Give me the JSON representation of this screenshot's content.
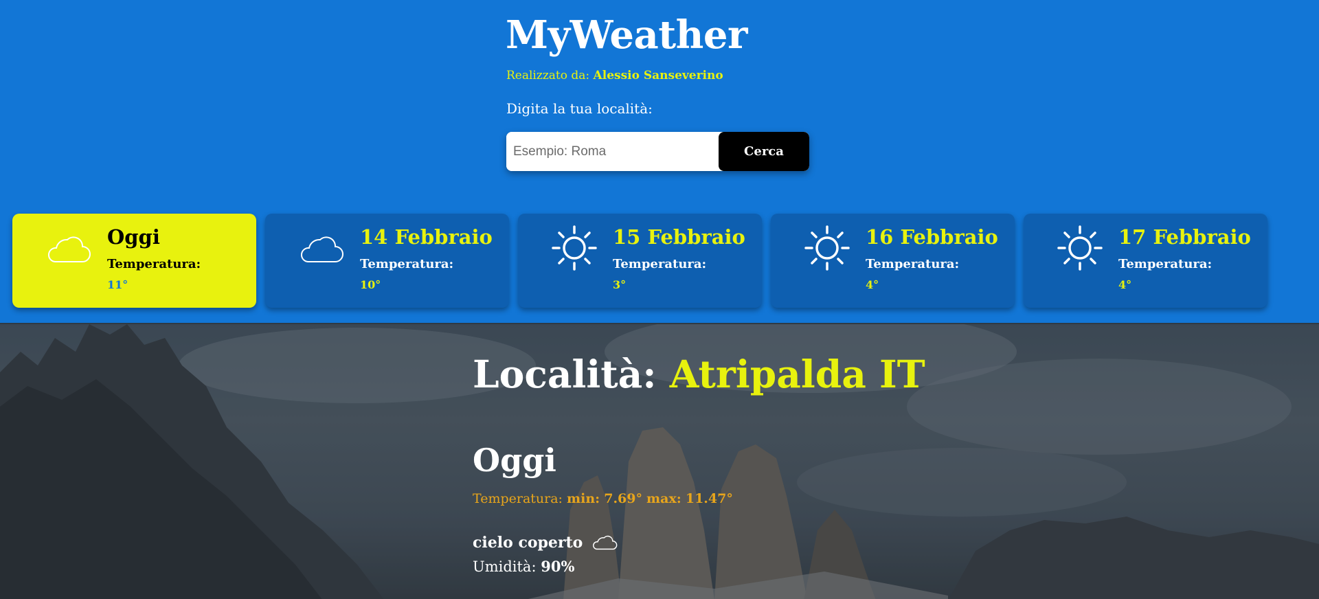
{
  "header": {
    "brand": "MyWeather",
    "credit_label": "Realizzato da:",
    "credit_name": "Alessio Sanseverino",
    "prompt": "Digita la tua località:"
  },
  "search": {
    "placeholder": "Esempio: Roma",
    "value": "",
    "button_label": "Cerca"
  },
  "forecast": [
    {
      "title": "Oggi",
      "temp_label": "Temperatura:",
      "temp": "11°",
      "icon": "cloud-icon",
      "selected": true
    },
    {
      "title": "14 Febbraio",
      "temp_label": "Temperatura:",
      "temp": "10°",
      "icon": "cloud-icon",
      "selected": false
    },
    {
      "title": "15 Febbraio",
      "temp_label": "Temperatura:",
      "temp": "3°",
      "icon": "sun-icon",
      "selected": false
    },
    {
      "title": "16 Febbraio",
      "temp_label": "Temperatura:",
      "temp": "4°",
      "icon": "sun-icon",
      "selected": false
    },
    {
      "title": "17 Febbraio",
      "temp_label": "Temperatura:",
      "temp": "4°",
      "icon": "sun-icon",
      "selected": false
    }
  ],
  "detail": {
    "location_label": "Località:",
    "location_value": "Atripalda IT",
    "day": "Oggi",
    "temp_label": "Temperatura:",
    "min_label": "min:",
    "min_value": "7.69°",
    "max_label": "max:",
    "max_value": "11.47°",
    "description": "cielo coperto",
    "description_icon": "cloud-icon",
    "humidity_label": "Umidità:",
    "humidity_value": "90%"
  },
  "colors": {
    "header_bg": "#1276d6",
    "card_bg": "#0e5fb0",
    "accent_yellow": "#e8f20e",
    "temp_orange": "#e8a51b",
    "button_bg": "#000000"
  }
}
